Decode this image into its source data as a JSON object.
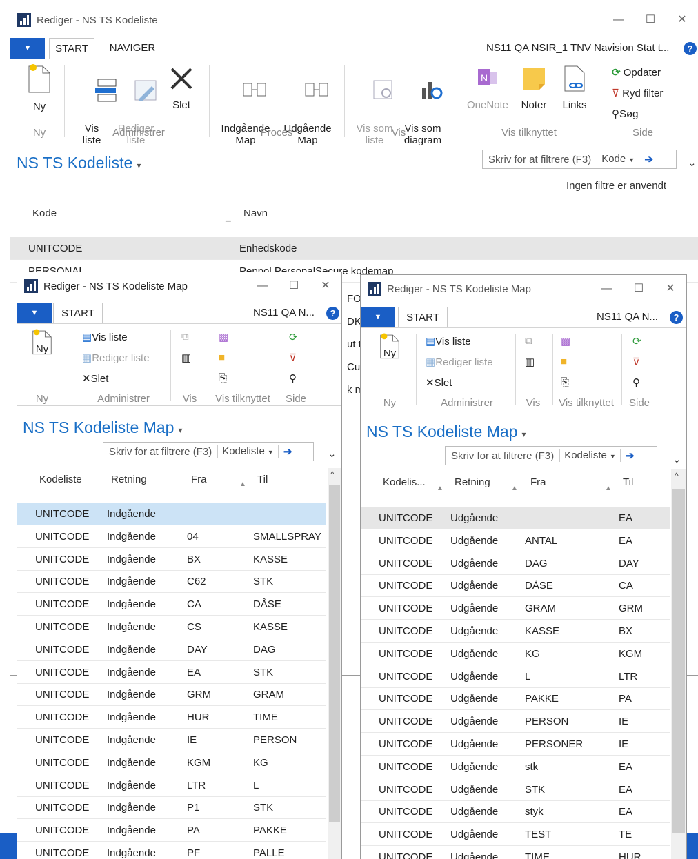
{
  "main": {
    "title": "Rediger - NS TS Kodeliste",
    "controls": {
      "min": "—",
      "max": "☐",
      "close": "✕"
    },
    "tabs": {
      "start": "START",
      "navigate": "NAVIGER"
    },
    "company": "NS11 QA NSIR_1 TNV Navision Stat t...",
    "ribbon": {
      "ny": "Ny",
      "vis_liste": "Vis\nliste",
      "rediger_liste": "Rediger\nliste",
      "slet": "Slet",
      "indgaaende_map": "Indgående\nMap",
      "udgaaende_map": "Udgående\nMap",
      "vis_som_liste": "Vis som\nliste",
      "vis_som_diagram": "Vis som\ndiagram",
      "onenote": "OneNote",
      "noter": "Noter",
      "links": "Links",
      "opdater": "Opdater",
      "ryd_filter": "Ryd filter",
      "soeg": "Søg",
      "groups": {
        "ny": "Ny",
        "administrer": "Administrer",
        "proces": "Proces",
        "vis": "Vis",
        "vis_tilknyttet": "Vis tilknyttet",
        "side": "Side"
      }
    },
    "page_title": "NS TS Kodeliste",
    "filter": {
      "placeholder": "Skriv for at filtrere (F3)",
      "field": "Kode"
    },
    "no_filters": "Ingen filtre er anvendt",
    "columns": {
      "kode": "Kode",
      "navn": "Navn"
    },
    "rows": [
      {
        "kode": "UNITCODE",
        "navn": "Enhedskode"
      },
      {
        "kode": "PERSONAL",
        "navn": "Peppol PersonalSecure kodemap"
      }
    ],
    "peek": [
      "FO",
      "DK",
      "ut t",
      "Cust",
      "k ma"
    ]
  },
  "map_left": {
    "title": "Rediger - NS TS Kodeliste Map",
    "tabs": {
      "start": "START"
    },
    "company": "NS11 QA N...",
    "ribbon": {
      "ny": "Ny",
      "vis_liste": "Vis liste",
      "rediger_liste": "Rediger liste",
      "slet": "Slet",
      "groups": {
        "ny": "Ny",
        "administrer": "Administrer",
        "vis": "Vis",
        "vis_tilknyttet": "Vis tilknyttet",
        "side": "Side"
      }
    },
    "page_title": "NS TS Kodeliste Map",
    "filter": {
      "placeholder": "Skriv for at filtrere (F3)",
      "field": "Kodeliste"
    },
    "columns": {
      "kodeliste": "Kodeliste",
      "retning": "Retning",
      "fra": "Fra",
      "til": "Til"
    },
    "rows": [
      {
        "k": "UNITCODE",
        "r": "Indgående",
        "f": "",
        "t": ""
      },
      {
        "k": "UNITCODE",
        "r": "Indgående",
        "f": "04",
        "t": "SMALLSPRAY"
      },
      {
        "k": "UNITCODE",
        "r": "Indgående",
        "f": "BX",
        "t": "KASSE"
      },
      {
        "k": "UNITCODE",
        "r": "Indgående",
        "f": "C62",
        "t": "STK"
      },
      {
        "k": "UNITCODE",
        "r": "Indgående",
        "f": "CA",
        "t": "DÅSE"
      },
      {
        "k": "UNITCODE",
        "r": "Indgående",
        "f": "CS",
        "t": "KASSE"
      },
      {
        "k": "UNITCODE",
        "r": "Indgående",
        "f": "DAY",
        "t": "DAG"
      },
      {
        "k": "UNITCODE",
        "r": "Indgående",
        "f": "EA",
        "t": "STK"
      },
      {
        "k": "UNITCODE",
        "r": "Indgående",
        "f": "GRM",
        "t": "GRAM"
      },
      {
        "k": "UNITCODE",
        "r": "Indgående",
        "f": "HUR",
        "t": "TIME"
      },
      {
        "k": "UNITCODE",
        "r": "Indgående",
        "f": "IE",
        "t": "PERSON"
      },
      {
        "k": "UNITCODE",
        "r": "Indgående",
        "f": "KGM",
        "t": "KG"
      },
      {
        "k": "UNITCODE",
        "r": "Indgående",
        "f": "LTR",
        "t": "L"
      },
      {
        "k": "UNITCODE",
        "r": "Indgående",
        "f": "P1",
        "t": "STK"
      },
      {
        "k": "UNITCODE",
        "r": "Indgående",
        "f": "PA",
        "t": "PAKKE"
      },
      {
        "k": "UNITCODE",
        "r": "Indgående",
        "f": "PF",
        "t": "PALLE"
      }
    ]
  },
  "map_right": {
    "title": "Rediger - NS TS Kodeliste Map",
    "tabs": {
      "start": "START"
    },
    "company": "NS11 QA N...",
    "ribbon": {
      "ny": "Ny",
      "vis_liste": "Vis liste",
      "rediger_liste": "Rediger liste",
      "slet": "Slet",
      "groups": {
        "ny": "Ny",
        "administrer": "Administrer",
        "vis": "Vis",
        "vis_tilknyttet": "Vis tilknyttet",
        "side": "Side"
      }
    },
    "page_title": "NS TS Kodeliste Map",
    "filter": {
      "placeholder": "Skriv for at filtrere (F3)",
      "field": "Kodeliste"
    },
    "columns": {
      "kodeliste": "Kodelis...",
      "retning": "Retning",
      "fra": "Fra",
      "til": "Til"
    },
    "rows": [
      {
        "k": "UNITCODE",
        "r": "Udgående",
        "f": "",
        "t": "EA"
      },
      {
        "k": "UNITCODE",
        "r": "Udgående",
        "f": "ANTAL",
        "t": "EA"
      },
      {
        "k": "UNITCODE",
        "r": "Udgående",
        "f": "DAG",
        "t": "DAY"
      },
      {
        "k": "UNITCODE",
        "r": "Udgående",
        "f": "DÅSE",
        "t": "CA"
      },
      {
        "k": "UNITCODE",
        "r": "Udgående",
        "f": "GRAM",
        "t": "GRM"
      },
      {
        "k": "UNITCODE",
        "r": "Udgående",
        "f": "KASSE",
        "t": "BX"
      },
      {
        "k": "UNITCODE",
        "r": "Udgående",
        "f": "KG",
        "t": "KGM"
      },
      {
        "k": "UNITCODE",
        "r": "Udgående",
        "f": "L",
        "t": "LTR"
      },
      {
        "k": "UNITCODE",
        "r": "Udgående",
        "f": "PAKKE",
        "t": "PA"
      },
      {
        "k": "UNITCODE",
        "r": "Udgående",
        "f": "PERSON",
        "t": "IE"
      },
      {
        "k": "UNITCODE",
        "r": "Udgående",
        "f": "PERSONER",
        "t": "IE"
      },
      {
        "k": "UNITCODE",
        "r": "Udgående",
        "f": "stk",
        "t": "EA"
      },
      {
        "k": "UNITCODE",
        "r": "Udgående",
        "f": "STK",
        "t": "EA"
      },
      {
        "k": "UNITCODE",
        "r": "Udgående",
        "f": "styk",
        "t": "EA"
      },
      {
        "k": "UNITCODE",
        "r": "Udgående",
        "f": "TEST",
        "t": "TE"
      },
      {
        "k": "UNITCODE",
        "r": "Udgående",
        "f": "TIME",
        "t": "HUR"
      }
    ]
  }
}
